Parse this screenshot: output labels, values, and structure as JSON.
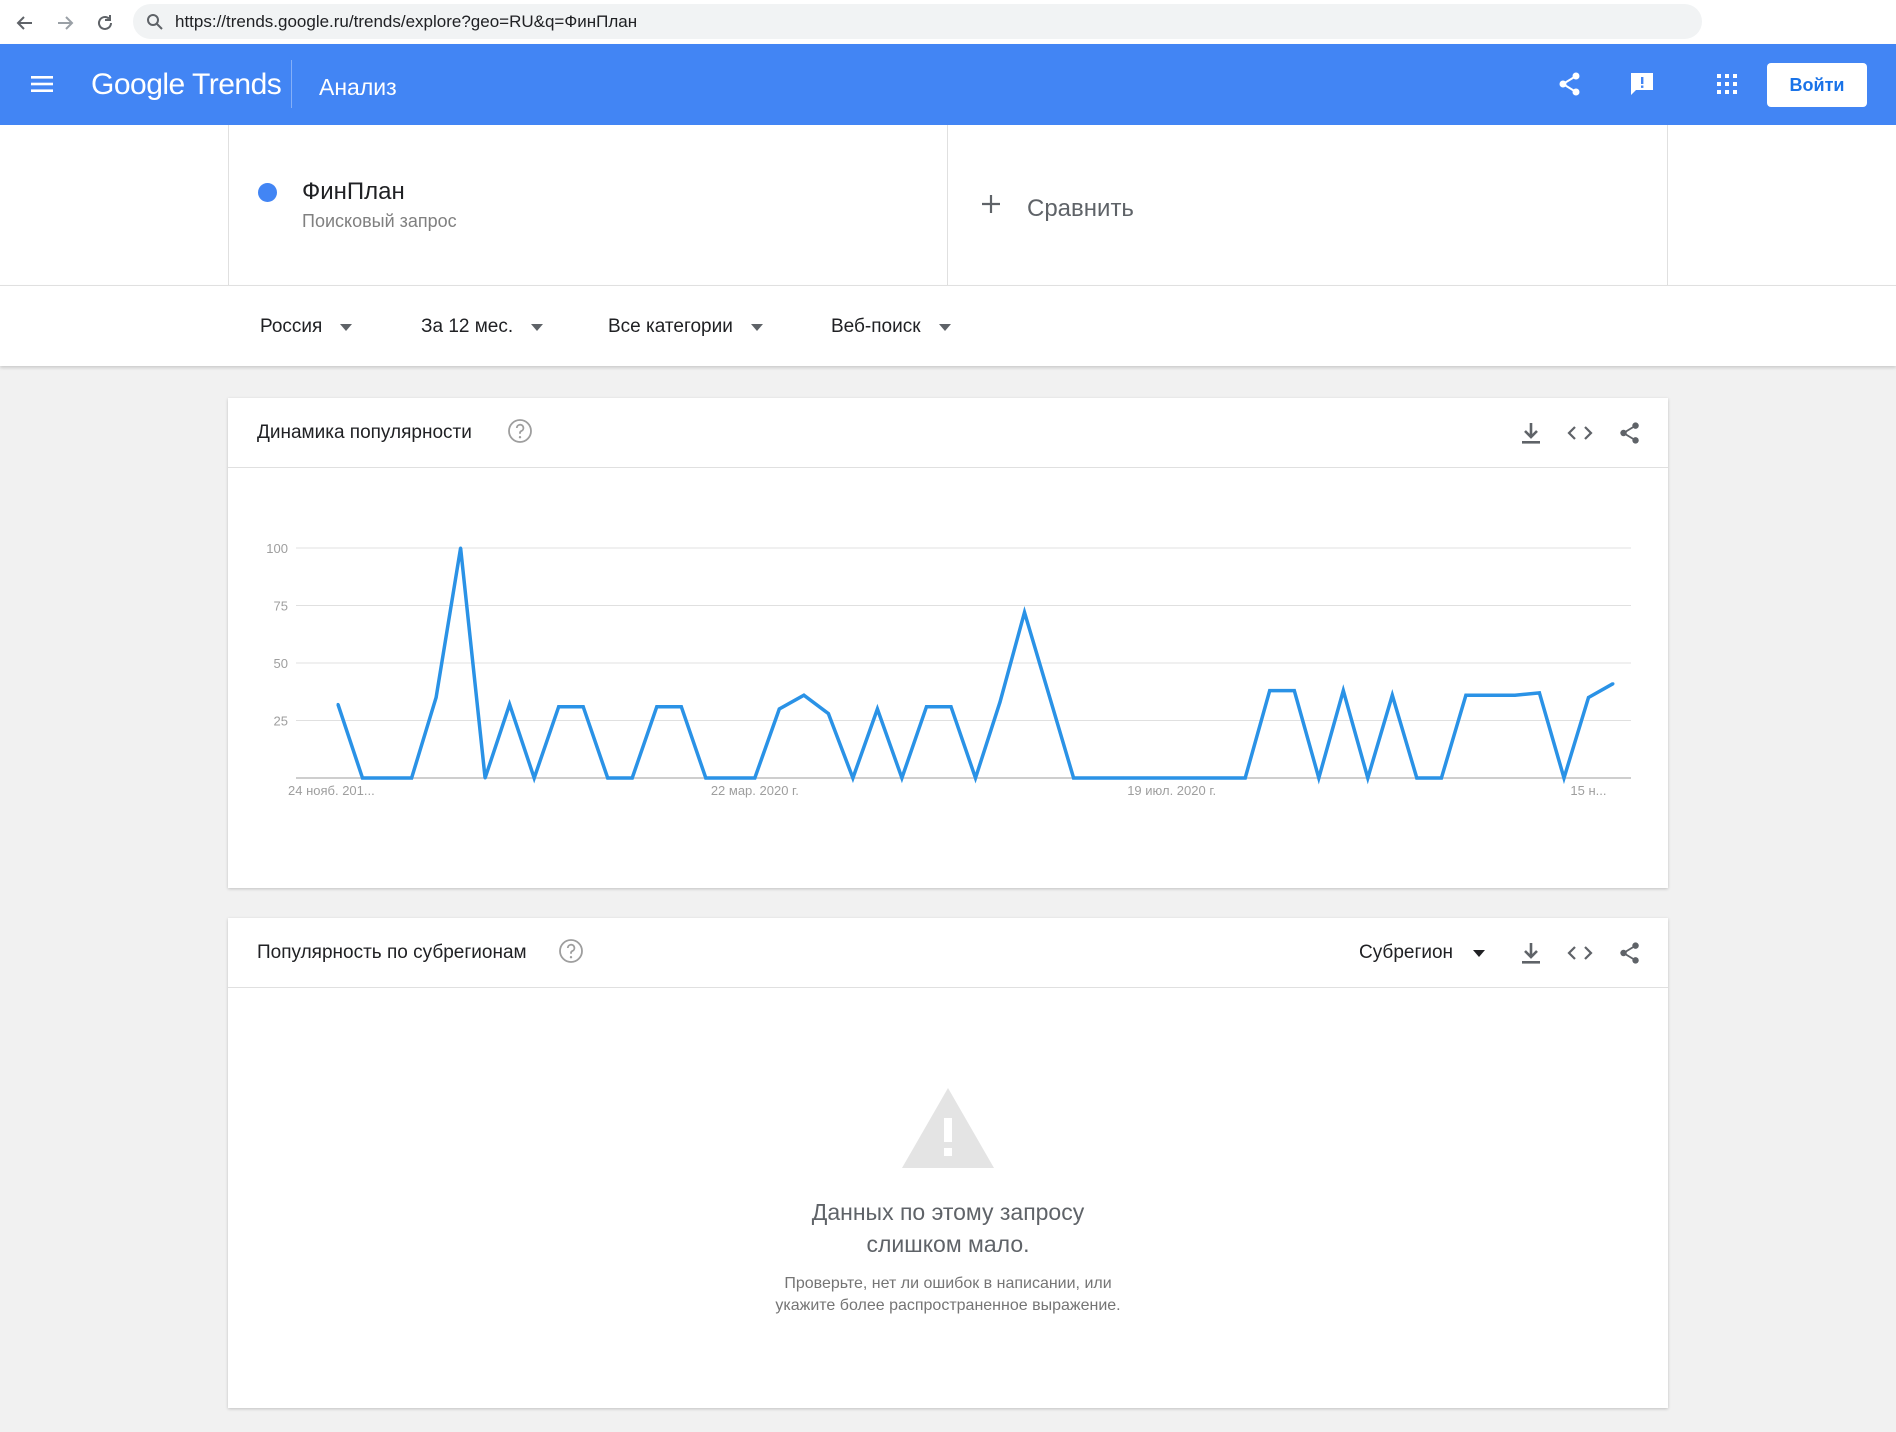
{
  "browser": {
    "url": "https://trends.google.ru/trends/explore?geo=RU&q=ФинПлан"
  },
  "header": {
    "brand": "Google Trends",
    "page_label": "Анализ",
    "login_label": "Войти",
    "accent_color": "#4285f4"
  },
  "term": {
    "name": "ФинПлан",
    "type": "Поисковый запрос",
    "color": "#4285f4"
  },
  "compare": {
    "label": "Сравнить"
  },
  "filters": {
    "region": "Россия",
    "period": "За 12 мес.",
    "category": "Все категории",
    "search_type": "Веб-поиск"
  },
  "interest_card": {
    "title": "Динамика популярности"
  },
  "subregion_card": {
    "title": "Популярность по субрегионам",
    "select_label": "Субрегион",
    "empty_title_line1": "Данных по этому запросу",
    "empty_title_line2": "слишком мало.",
    "empty_sub_line1": "Проверьте, нет ли ошибок в написании, или",
    "empty_sub_line2": "укажите более распространенное выражение."
  },
  "chart_data": {
    "type": "line",
    "ylim": [
      0,
      100
    ],
    "y_ticks": [
      "25",
      "50",
      "75",
      "100"
    ],
    "x_tick_labels": [
      "24 нояб. 201...",
      "22 мар. 2020 г.",
      "19 июл. 2020 г.",
      "15 н..."
    ],
    "x_tick_index": [
      0,
      17,
      34,
      51
    ],
    "grid": true,
    "line_color": "#2a92e6",
    "series": [
      {
        "values": [
          32,
          0,
          0,
          0,
          35,
          100,
          0,
          32,
          0,
          31,
          31,
          0,
          0,
          31,
          31,
          0,
          0,
          0,
          30,
          36,
          28,
          0,
          30,
          0,
          31,
          31,
          0,
          33,
          72,
          36,
          0,
          0,
          0,
          0,
          0,
          0,
          0,
          0,
          38,
          38,
          0,
          38,
          0,
          36,
          0,
          0,
          36,
          36,
          36,
          37,
          0,
          35,
          41
        ]
      }
    ]
  }
}
